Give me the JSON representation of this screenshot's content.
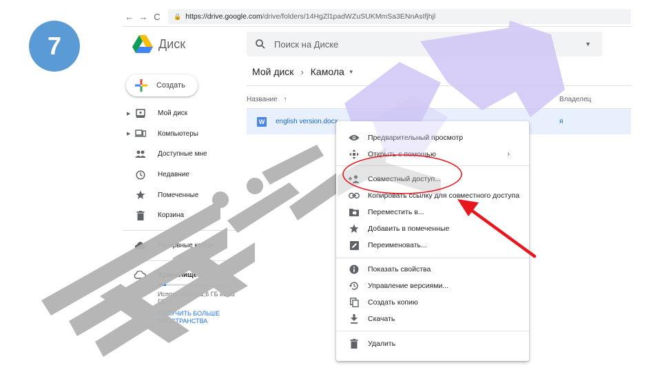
{
  "step": {
    "number": "7"
  },
  "browser": {
    "url_host": "https://drive.google.com",
    "url_path": "/drive/folders/14HgZl1padWZuSUKMmSa3ENnAsIfjhjl"
  },
  "header": {
    "app_title": "Диск",
    "search_placeholder": "Поиск на Диске"
  },
  "create_button": {
    "label": "Создать"
  },
  "sidebar": {
    "items": [
      {
        "label": "Мой диск"
      },
      {
        "label": "Компьютеры"
      },
      {
        "label": "Доступные мне"
      },
      {
        "label": "Недавние"
      },
      {
        "label": "Помеченные"
      },
      {
        "label": "Корзина"
      }
    ],
    "backup_label": "Резервные копии",
    "storage": {
      "title": "Хранилище",
      "used_text": "Использовано 1,6 ГБ из 15 ГБ",
      "used_fraction": 0.107,
      "upgrade_text": "ПОЛУЧИТЬ БОЛЬШЕ ПРОСТРАНСТВА"
    }
  },
  "breadcrumb": {
    "root": "Мой диск",
    "current": "Камола"
  },
  "file_list": {
    "col_name": "Название",
    "col_owner": "Владелец",
    "rows": [
      {
        "name": "english version.docx",
        "owner": "я",
        "icon_letter": "W"
      }
    ]
  },
  "context_menu": {
    "items": [
      {
        "label": "Предварительный просмотр",
        "icon": "eye-icon"
      },
      {
        "label": "Открыть с помощью",
        "icon": "open-with-icon",
        "submenu": "›"
      },
      {
        "label": "Совместный доступ...",
        "icon": "add-person-icon"
      },
      {
        "label": "Копировать ссылку для совместного доступа",
        "icon": "link-icon"
      },
      {
        "label": "Переместить в...",
        "icon": "move-folder-icon"
      },
      {
        "label": "Добавить в помеченные",
        "icon": "star-icon"
      },
      {
        "label": "Переименовать...",
        "icon": "rename-icon"
      },
      {
        "label": "Показать свойства",
        "icon": "info-icon"
      },
      {
        "label": "Управление версиями...",
        "icon": "history-icon"
      },
      {
        "label": "Создать копию",
        "icon": "copy-icon"
      },
      {
        "label": "Скачать",
        "icon": "download-icon"
      },
      {
        "label": "Удалить",
        "icon": "trash-icon"
      }
    ]
  },
  "watermark": {
    "text": "Hujjat 24"
  },
  "colors": {
    "step_badge": "#5b9bd5",
    "selected_row": "#e8f0fe",
    "link_blue": "#1a73e8",
    "annotation_red": "#e8171d",
    "watermark_gray": "#b3b3b3",
    "watermark_purple": "#cfc6f5"
  }
}
